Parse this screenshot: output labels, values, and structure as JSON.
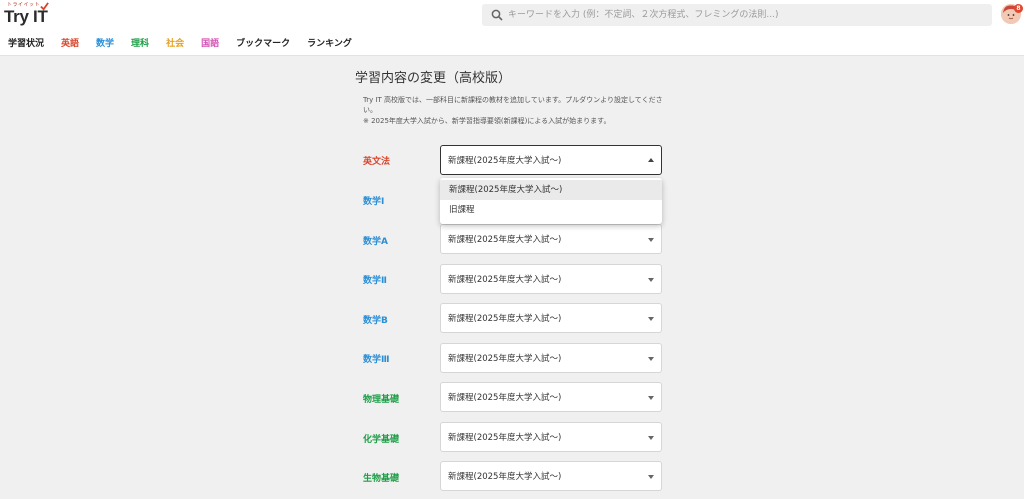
{
  "header": {
    "logo_sub": "トライイット",
    "logo_text": "Try IT",
    "search_placeholder": "キーワードを入力 (例：不定詞、２次方程式、フレミングの法則...)",
    "search_icon": "search-icon",
    "avatar_badge": "8",
    "nav": [
      {
        "label": "学習状況",
        "color": "#222222"
      },
      {
        "label": "英語",
        "color": "#d9452b"
      },
      {
        "label": "数学",
        "color": "#2b8fd6"
      },
      {
        "label": "理科",
        "color": "#1e9e47"
      },
      {
        "label": "社会",
        "color": "#e8a01c"
      },
      {
        "label": "国語",
        "color": "#d455b5"
      },
      {
        "label": "ブックマーク",
        "color": "#222222"
      },
      {
        "label": "ランキング",
        "color": "#222222"
      }
    ]
  },
  "main": {
    "title": "学習内容の変更（高校版）",
    "description": "Try IT 高校版では、一部科目に新課程の教材を追加しています。プルダウンより設定してください。",
    "note": "※ 2025年度大学入試から、新学習指導要領(新課程)による入試が始まります。",
    "subjects": [
      {
        "label": "英文法",
        "color": "#d9452b",
        "value": "新課程(2025年度大学入試〜)"
      },
      {
        "label": "数学Ⅰ",
        "color": "#2b8fd6",
        "value": "新課程(2025年度大学入試〜)"
      },
      {
        "label": "数学A",
        "color": "#2b8fd6",
        "value": "新課程(2025年度大学入試〜)"
      },
      {
        "label": "数学Ⅱ",
        "color": "#2b8fd6",
        "value": "新課程(2025年度大学入試〜)"
      },
      {
        "label": "数学B",
        "color": "#2b8fd6",
        "value": "新課程(2025年度大学入試〜)"
      },
      {
        "label": "数学Ⅲ",
        "color": "#2b8fd6",
        "value": "新課程(2025年度大学入試〜)"
      },
      {
        "label": "物理基礎",
        "color": "#1e9e47",
        "value": "新課程(2025年度大学入試〜)"
      },
      {
        "label": "化学基礎",
        "color": "#1e9e47",
        "value": "新課程(2025年度大学入試〜)"
      },
      {
        "label": "生物基礎",
        "color": "#1e9e47",
        "value": "新課程(2025年度大学入試〜)"
      }
    ],
    "dropdown_options": [
      {
        "label": "新課程(2025年度大学入試〜)",
        "selected": true
      },
      {
        "label": "旧課程",
        "selected": false
      }
    ]
  }
}
